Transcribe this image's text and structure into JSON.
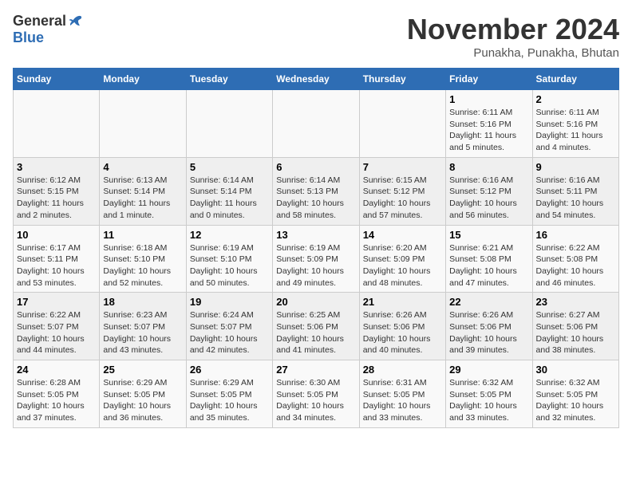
{
  "header": {
    "logo_general": "General",
    "logo_blue": "Blue",
    "month_title": "November 2024",
    "subtitle": "Punakha, Punakha, Bhutan"
  },
  "calendar": {
    "days_of_week": [
      "Sunday",
      "Monday",
      "Tuesday",
      "Wednesday",
      "Thursday",
      "Friday",
      "Saturday"
    ],
    "weeks": [
      [
        {
          "day": "",
          "info": ""
        },
        {
          "day": "",
          "info": ""
        },
        {
          "day": "",
          "info": ""
        },
        {
          "day": "",
          "info": ""
        },
        {
          "day": "",
          "info": ""
        },
        {
          "day": "1",
          "info": "Sunrise: 6:11 AM\nSunset: 5:16 PM\nDaylight: 11 hours\nand 5 minutes."
        },
        {
          "day": "2",
          "info": "Sunrise: 6:11 AM\nSunset: 5:16 PM\nDaylight: 11 hours\nand 4 minutes."
        }
      ],
      [
        {
          "day": "3",
          "info": "Sunrise: 6:12 AM\nSunset: 5:15 PM\nDaylight: 11 hours\nand 2 minutes."
        },
        {
          "day": "4",
          "info": "Sunrise: 6:13 AM\nSunset: 5:14 PM\nDaylight: 11 hours\nand 1 minute."
        },
        {
          "day": "5",
          "info": "Sunrise: 6:14 AM\nSunset: 5:14 PM\nDaylight: 11 hours\nand 0 minutes."
        },
        {
          "day": "6",
          "info": "Sunrise: 6:14 AM\nSunset: 5:13 PM\nDaylight: 10 hours\nand 58 minutes."
        },
        {
          "day": "7",
          "info": "Sunrise: 6:15 AM\nSunset: 5:12 PM\nDaylight: 10 hours\nand 57 minutes."
        },
        {
          "day": "8",
          "info": "Sunrise: 6:16 AM\nSunset: 5:12 PM\nDaylight: 10 hours\nand 56 minutes."
        },
        {
          "day": "9",
          "info": "Sunrise: 6:16 AM\nSunset: 5:11 PM\nDaylight: 10 hours\nand 54 minutes."
        }
      ],
      [
        {
          "day": "10",
          "info": "Sunrise: 6:17 AM\nSunset: 5:11 PM\nDaylight: 10 hours\nand 53 minutes."
        },
        {
          "day": "11",
          "info": "Sunrise: 6:18 AM\nSunset: 5:10 PM\nDaylight: 10 hours\nand 52 minutes."
        },
        {
          "day": "12",
          "info": "Sunrise: 6:19 AM\nSunset: 5:10 PM\nDaylight: 10 hours\nand 50 minutes."
        },
        {
          "day": "13",
          "info": "Sunrise: 6:19 AM\nSunset: 5:09 PM\nDaylight: 10 hours\nand 49 minutes."
        },
        {
          "day": "14",
          "info": "Sunrise: 6:20 AM\nSunset: 5:09 PM\nDaylight: 10 hours\nand 48 minutes."
        },
        {
          "day": "15",
          "info": "Sunrise: 6:21 AM\nSunset: 5:08 PM\nDaylight: 10 hours\nand 47 minutes."
        },
        {
          "day": "16",
          "info": "Sunrise: 6:22 AM\nSunset: 5:08 PM\nDaylight: 10 hours\nand 46 minutes."
        }
      ],
      [
        {
          "day": "17",
          "info": "Sunrise: 6:22 AM\nSunset: 5:07 PM\nDaylight: 10 hours\nand 44 minutes."
        },
        {
          "day": "18",
          "info": "Sunrise: 6:23 AM\nSunset: 5:07 PM\nDaylight: 10 hours\nand 43 minutes."
        },
        {
          "day": "19",
          "info": "Sunrise: 6:24 AM\nSunset: 5:07 PM\nDaylight: 10 hours\nand 42 minutes."
        },
        {
          "day": "20",
          "info": "Sunrise: 6:25 AM\nSunset: 5:06 PM\nDaylight: 10 hours\nand 41 minutes."
        },
        {
          "day": "21",
          "info": "Sunrise: 6:26 AM\nSunset: 5:06 PM\nDaylight: 10 hours\nand 40 minutes."
        },
        {
          "day": "22",
          "info": "Sunrise: 6:26 AM\nSunset: 5:06 PM\nDaylight: 10 hours\nand 39 minutes."
        },
        {
          "day": "23",
          "info": "Sunrise: 6:27 AM\nSunset: 5:06 PM\nDaylight: 10 hours\nand 38 minutes."
        }
      ],
      [
        {
          "day": "24",
          "info": "Sunrise: 6:28 AM\nSunset: 5:05 PM\nDaylight: 10 hours\nand 37 minutes."
        },
        {
          "day": "25",
          "info": "Sunrise: 6:29 AM\nSunset: 5:05 PM\nDaylight: 10 hours\nand 36 minutes."
        },
        {
          "day": "26",
          "info": "Sunrise: 6:29 AM\nSunset: 5:05 PM\nDaylight: 10 hours\nand 35 minutes."
        },
        {
          "day": "27",
          "info": "Sunrise: 6:30 AM\nSunset: 5:05 PM\nDaylight: 10 hours\nand 34 minutes."
        },
        {
          "day": "28",
          "info": "Sunrise: 6:31 AM\nSunset: 5:05 PM\nDaylight: 10 hours\nand 33 minutes."
        },
        {
          "day": "29",
          "info": "Sunrise: 6:32 AM\nSunset: 5:05 PM\nDaylight: 10 hours\nand 33 minutes."
        },
        {
          "day": "30",
          "info": "Sunrise: 6:32 AM\nSunset: 5:05 PM\nDaylight: 10 hours\nand 32 minutes."
        }
      ]
    ]
  }
}
